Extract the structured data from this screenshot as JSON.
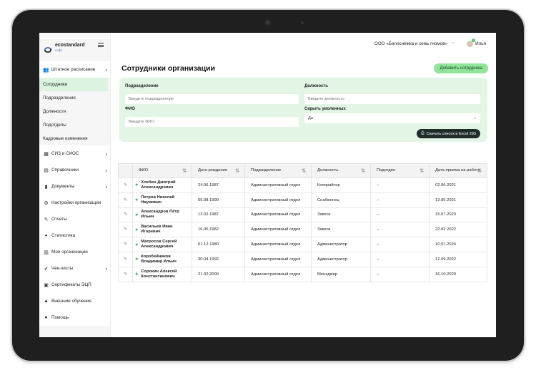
{
  "brand": {
    "name": "ecostandard",
    "sub": "софт"
  },
  "header": {
    "org": "ООО «Белоснежка и семь гномов»",
    "user": "Илья",
    "notifications": "3"
  },
  "sidebar": {
    "items": [
      {
        "label": "Штатное расписание",
        "icon": "people-icon",
        "chevron": true
      },
      {
        "label": "Сотрудники",
        "active": true
      },
      {
        "label": "Подразделения"
      },
      {
        "label": "Должности"
      },
      {
        "label": "Подотделы"
      },
      {
        "label": "Кадровые изменения"
      },
      {
        "label": "СИЗ и СИОС",
        "icon": "grid-icon",
        "chevron": true
      },
      {
        "label": "Справочники",
        "icon": "book-icon",
        "chevron": true
      },
      {
        "label": "Документы",
        "icon": "document-icon",
        "chevron": true
      },
      {
        "label": "Настройки организации",
        "icon": "gear-icon"
      },
      {
        "label": "Отчеты",
        "icon": "pencil-icon"
      },
      {
        "label": "Статистика",
        "icon": "pie-chart-icon"
      },
      {
        "label": "Мои организации",
        "icon": "building-icon"
      },
      {
        "label": "Чек-листы",
        "icon": "check-icon",
        "chevron": true
      },
      {
        "label": "Сертификаты ЭЦП",
        "icon": "certificate-icon"
      },
      {
        "label": "Внешние обучения",
        "icon": "graduation-cap-icon"
      },
      {
        "label": "Помощь",
        "icon": "info-icon"
      }
    ]
  },
  "page": {
    "title": "Сотрудники организации",
    "add_button": "Добавить сотрудника"
  },
  "filters": {
    "department": {
      "label": "Подразделение",
      "placeholder": "Введите подразделение"
    },
    "position": {
      "label": "Должность",
      "placeholder": "Введите должность"
    },
    "fio": {
      "label": "ФИО",
      "placeholder": "Введите ФИО"
    },
    "fired": {
      "label": "Скрыть уволенных",
      "value": "Да"
    },
    "excel_button": "Скачать список в Excel 293"
  },
  "table": {
    "headers": [
      "ФИО",
      "Дата рождения",
      "Подразделение",
      "Должность",
      "Подотдел",
      "Дата приема на работу"
    ],
    "rows": [
      {
        "name": "Хлебин Дмитрий Александрович",
        "birth": "24.06.1987",
        "dept": "Административный отдел",
        "position": "Копирайтер",
        "sub": "–",
        "hired": "02.06.2021"
      },
      {
        "name": "Петров Николай Наумович",
        "birth": "05.08.1990",
        "dept": "Административный отдел",
        "position": "Снабженец",
        "sub": "–",
        "hired": "13.05.2021"
      },
      {
        "name": "Александров Пётр Ильич",
        "birth": "13.02.1987",
        "dept": "Административный отдел",
        "position": "Завхоз",
        "sub": "–",
        "hired": "15.07.2023"
      },
      {
        "name": "Васильев Иван Игоревич",
        "birth": "16.05.1982",
        "dept": "Административный отдел",
        "position": "Завхоз",
        "sub": "–",
        "hired": "22.02.2022"
      },
      {
        "name": "Матросов Сергей Александрович",
        "birth": "01.12.1980",
        "dept": "Административный отдел",
        "position": "Администратор",
        "sub": "–",
        "hired": "10.01.2024"
      },
      {
        "name": "Коробейников Владимир Ильич",
        "birth": "30.04.1992",
        "dept": "Административный отдел",
        "position": "Администратор",
        "sub": "–",
        "hired": "12.09.2022"
      },
      {
        "name": "Сорокин Алексей Константинович",
        "birth": "21.02.2000",
        "dept": "Административный отдел",
        "position": "Менеджер",
        "sub": "–",
        "hired": "16.10.2020"
      }
    ]
  },
  "colors": {
    "accent": "#8fe59a",
    "filter_bg": "#e3f6e5",
    "active_nav": "#dcf3df",
    "excel_btn": "#1f2d2a"
  }
}
